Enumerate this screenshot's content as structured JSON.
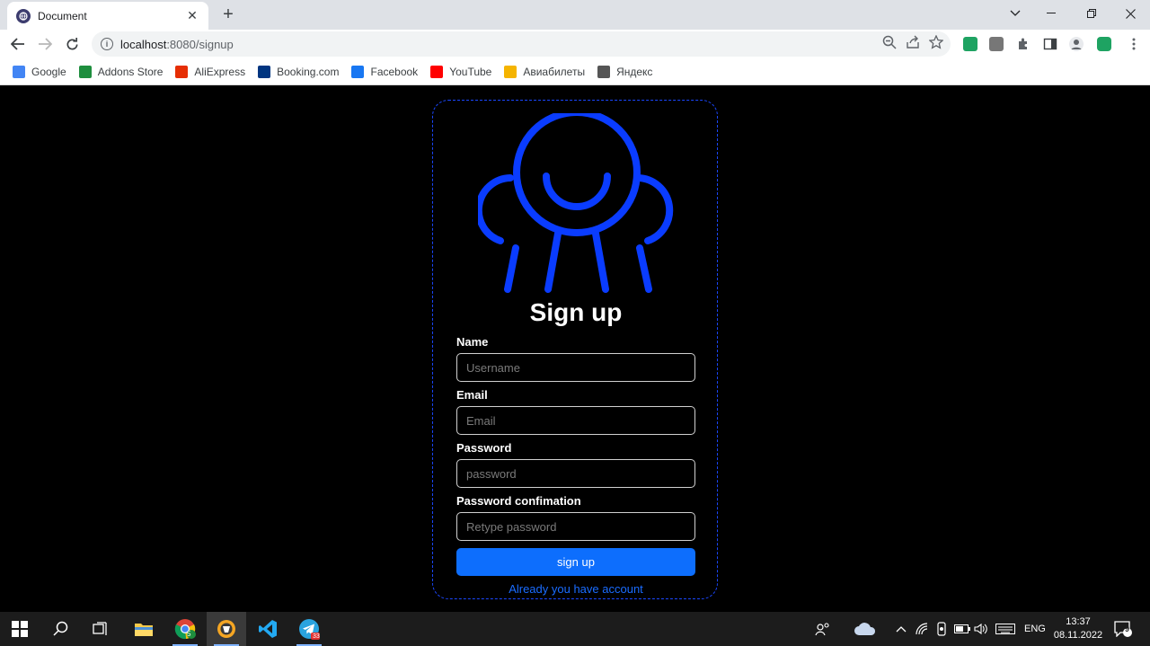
{
  "browser": {
    "tab_title": "Document",
    "url_host": "localhost",
    "url_rest": ":8080/signup",
    "bookmarks": [
      {
        "label": "Google",
        "icon": "google-icon",
        "color": "#4285f4"
      },
      {
        "label": "Addons Store",
        "icon": "addons-store-icon",
        "color": "#1e8e3e"
      },
      {
        "label": "AliExpress",
        "icon": "aliexpress-icon",
        "color": "#e62e04"
      },
      {
        "label": "Booking.com",
        "icon": "booking-icon",
        "color": "#003580"
      },
      {
        "label": "Facebook",
        "icon": "facebook-icon",
        "color": "#1877f2"
      },
      {
        "label": "YouTube",
        "icon": "youtube-icon",
        "color": "#ff0000"
      },
      {
        "label": "Авиабилеты",
        "icon": "aviabilety-icon",
        "color": "#f5b400"
      },
      {
        "label": "Яндекс",
        "icon": "yandex-icon",
        "color": "#555555"
      }
    ]
  },
  "signup": {
    "title": "Sign up",
    "name_label": "Name",
    "name_placeholder": "Username",
    "email_label": "Email",
    "email_placeholder": "Email",
    "password_label": "Password",
    "password_placeholder": "password",
    "confirm_label": "Password confimation",
    "confirm_placeholder": "Retype password",
    "submit_label": "sign up",
    "login_link": "Already you have account",
    "accent_color": "#0d6efd",
    "logo_color": "#0a3cff"
  },
  "taskbar": {
    "language": "ENG",
    "time": "13:37",
    "date": "08.11.2022",
    "notification_count": "9",
    "chrome_badge": "5",
    "telegram_badge": "33"
  }
}
